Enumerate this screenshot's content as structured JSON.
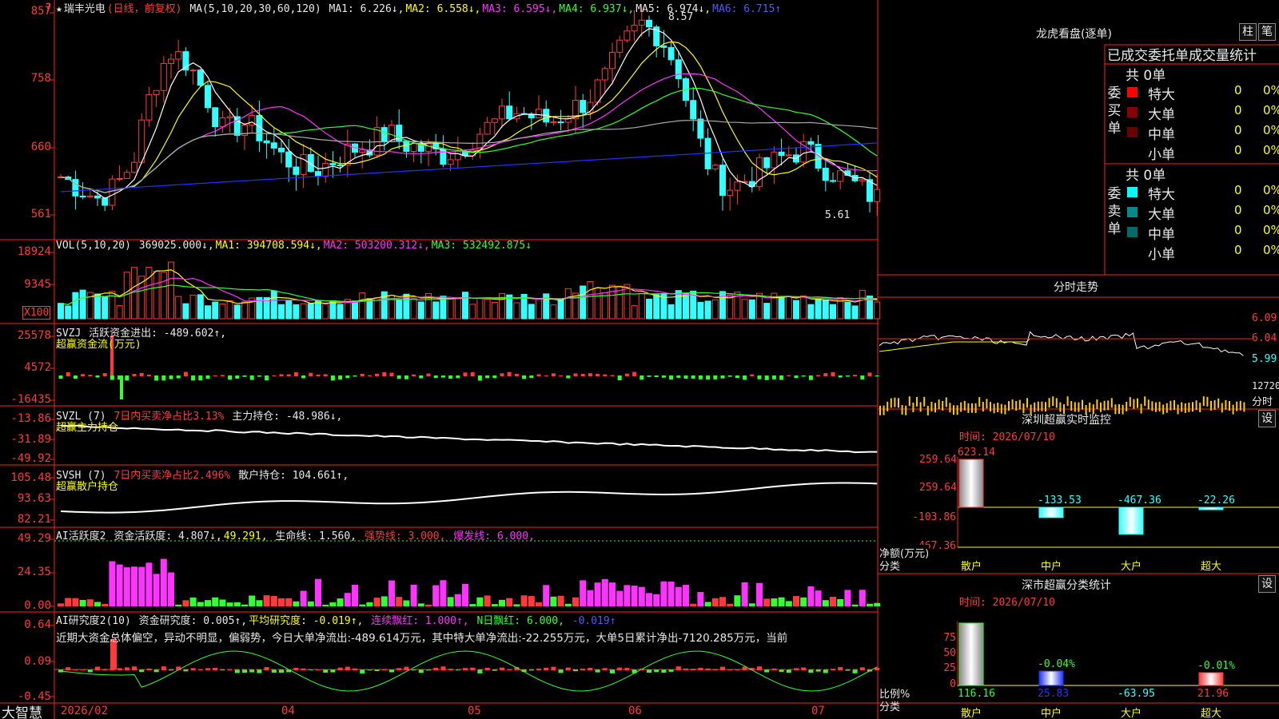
{
  "colors": {
    "up": "#ff3a3a",
    "down": "#33ffff",
    "grid": "#ff2020",
    "ma1": "#ffffff",
    "ma2": "#ffff00",
    "ma3": "#ff33ff",
    "ma4": "#33ff33",
    "ma5": "#aaaaaa",
    "ma6": "#2233ff"
  },
  "price_legend": {
    "star": "★",
    "name": "瑞丰光电",
    "mode": "(日线，前复权)",
    "ma": "MA(5,10,20,30,60,120)",
    "ma1": "MA1: 6.226↓,",
    "ma2": "MA2: 6.558↓,",
    "ma3": "MA3: 6.595↓,",
    "ma4": "MA4: 6.937↓,",
    "ma5": "MA5: 6.974↓,",
    "ma6": "MA6: 6.715↑"
  },
  "price_axis": [
    "857",
    "758",
    "660",
    "561"
  ],
  "price_marks": {
    "high": "8.57",
    "low": "5.61"
  },
  "vol_legend": {
    "name": "VOL(5,10,20)",
    "vol": "369025.000↓,",
    "ma1": "MA1: 394708.594↓,",
    "ma2": "MA2: 503200.312↓,",
    "ma3": "MA3: 532492.875↓"
  },
  "vol_axis": [
    "18924",
    "9345"
  ],
  "vol_unit": "X100",
  "svzj_legend": {
    "name": "SVZJ",
    "text": "活跃资金进出: -489.602↑,",
    "sub": "超赢资金流(万元)"
  },
  "svzj_axis": [
    "25578",
    "4572",
    "-16435"
  ],
  "svzl_legend": {
    "name": "SVZL (7)",
    "t1": "7日内买卖净占比3.13%",
    "t2": "主力持仓: -48.986↓,",
    "sub": "超赢主力持仓"
  },
  "svzl_axis": [
    "-13.86",
    "-31.89",
    "-49.92"
  ],
  "svsh_legend": {
    "name": "SVSH (7)",
    "t1": "7日内买卖净占比2.496%",
    "t2": "散户持仓: 104.661↑,",
    "sub": "超赢散户持仓"
  },
  "svsh_axis": [
    "105.48",
    "93.63",
    "82.21"
  ],
  "ai_legend": {
    "name": "AI活跃度2",
    "t1": "资金活跃度: 4.807↓,",
    "t2": "49.291,",
    "t3": "生命线: 1.560,",
    "t4": "强势线: 3.000,",
    "t5": "爆发线: 6.000,"
  },
  "ai_axis": [
    "49.29",
    "24.35",
    "0.00"
  ],
  "ar_legend": {
    "name": "AI研究度2(10)",
    "t1": "资金研究度: 0.005↑,",
    "t2": "平均研究度: -0.019↑,",
    "t3": "连续飘红: 1.000↑,",
    "t4": "N日飘红: 6.000,",
    "t5": "-0.019↑"
  },
  "ar_text": "近期大资金总体偏空，异动不明显，偏弱势，今日大单净流出:-489.614万元，其中特大单净流出:-22.255万元，大单5日累计净出-7120.285万元，当前",
  "ar_axis": [
    "0.64",
    "0.09",
    "-0.45"
  ],
  "date_axis": [
    "2026/02",
    "04",
    "05",
    "06",
    "07"
  ],
  "logo": "大智慧",
  "longhu": {
    "title": "龙虎看盘(逐单)",
    "btn1": "柱",
    "btn2": "笔",
    "tabs": "已成交委托单成交量统计",
    "buy_label": "委买单",
    "sell_label": "委卖单",
    "buy_total": "共 0单",
    "sell_total": "共 0单",
    "rows": [
      {
        "name": "特大",
        "qty": "0",
        "pct": "0%"
      },
      {
        "name": "大单",
        "qty": "0",
        "pct": "0%"
      },
      {
        "name": "中单",
        "qty": "0",
        "pct": "0%"
      },
      {
        "name": "小单",
        "qty": "0",
        "pct": "0%"
      }
    ],
    "buy_colors": [
      "#ff0000",
      "#8b0000",
      "#6b0000"
    ],
    "sell_colors": [
      "#00ffff",
      "#008b8b",
      "#006b6b"
    ]
  },
  "fenshi": {
    "title": "分时走势",
    "axis": [
      "6.09",
      "6.04",
      "5.99",
      "12720",
      "分时"
    ]
  },
  "sz_monitor": {
    "title": "深圳超赢实时监控",
    "btn": "设",
    "time": "时间: 2026/07/10",
    "axis": [
      "623.14",
      "259.64",
      "-103.86",
      "-467.36"
    ],
    "unit": "净额(万元)",
    "cat_label": "分类",
    "values": [
      {
        "cat": "散户",
        "val": "623.14",
        "num": 623.14
      },
      {
        "cat": "中户",
        "val": "-133.53",
        "num": -133.53
      },
      {
        "cat": "大户",
        "val": "-467.36",
        "num": -467.36
      },
      {
        "cat": "超大",
        "val": "-22.26",
        "num": -22.26
      }
    ]
  },
  "sz_class": {
    "title": "深市超赢分类统计",
    "btn": "设",
    "time": "时间: 2026/07/10",
    "axis": [
      "75",
      "50",
      "25",
      "0"
    ],
    "unit": "比例%",
    "cat_label": "分类",
    "values": [
      {
        "cat": "散户",
        "val": "116.16",
        "top": ""
      },
      {
        "cat": "中户",
        "val": "25.83",
        "top": "-0.04%"
      },
      {
        "cat": "大户",
        "val": "-63.95",
        "top": ""
      },
      {
        "cat": "超大",
        "val": "21.96",
        "top": "-0.01%"
      }
    ]
  }
}
